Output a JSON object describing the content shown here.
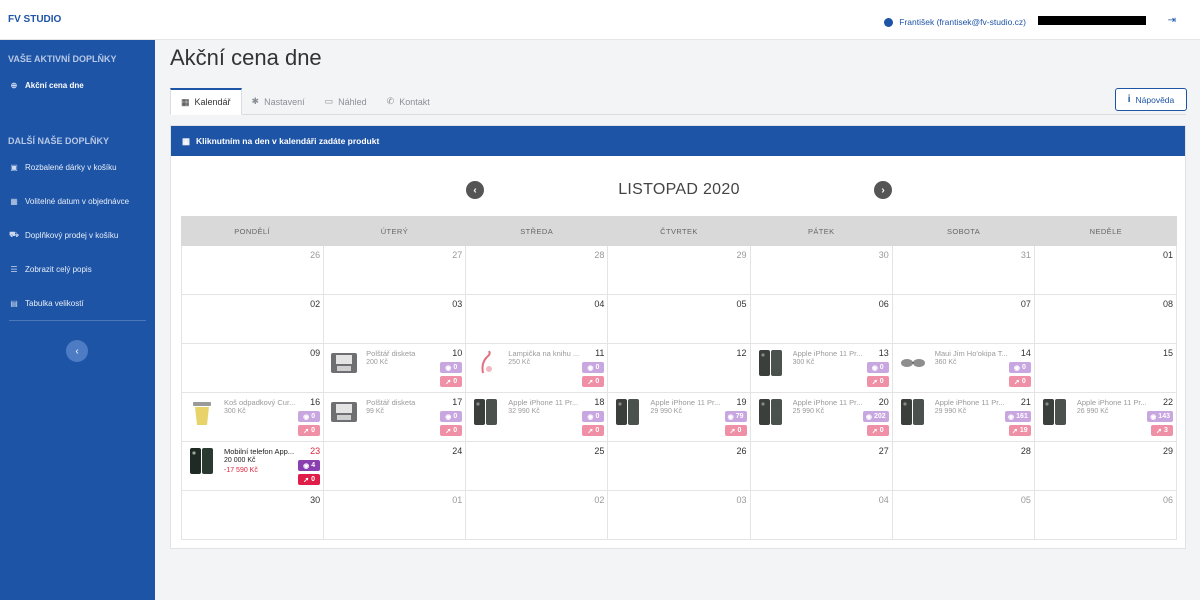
{
  "app": {
    "brand": "FV STUDIO"
  },
  "sidebar": {
    "active_heading": "VAŠE AKTIVNÍ DOPLŇKY",
    "active_item": "Akční cena dne",
    "more_heading": "DALŠÍ NAŠE DOPLŇKY",
    "items": [
      {
        "label": "Rozbalené dárky v košíku",
        "icon": "gift-icon"
      },
      {
        "label": "Volitelné datum v objednávce",
        "icon": "calendar-icon"
      },
      {
        "label": "Doplňkový prodej v košíku",
        "icon": "cart-icon"
      },
      {
        "label": "Zobrazit celý popis",
        "icon": "list-icon"
      },
      {
        "label": "Tabulka velikostí",
        "icon": "table-icon"
      }
    ]
  },
  "header": {
    "user": "František (frantisek@fv-studio.cz)"
  },
  "page": {
    "title": "Akční cena dne",
    "tabs": [
      {
        "label": "Kalendář",
        "icon": "calendar-icon"
      },
      {
        "label": "Nastavení",
        "icon": "gear-icon"
      },
      {
        "label": "Náhled",
        "icon": "monitor-icon"
      },
      {
        "label": "Kontakt",
        "icon": "phone-icon"
      }
    ],
    "help": "Nápověda"
  },
  "calendar": {
    "header_text": "Kliknutním na den v kalendáři zadáte produkt",
    "month": "LISTOPAD 2020",
    "weekdays": [
      "PONDĚLÍ",
      "ÚTERÝ",
      "STŘEDA",
      "ČTVRTEK",
      "PÁTEK",
      "SOBOTA",
      "NEDĚLE"
    ],
    "days": [
      {
        "d": "26",
        "muted": true
      },
      {
        "d": "27",
        "muted": true
      },
      {
        "d": "28",
        "muted": true
      },
      {
        "d": "29",
        "muted": true
      },
      {
        "d": "30",
        "muted": true
      },
      {
        "d": "31",
        "muted": true
      },
      {
        "d": "01"
      },
      {
        "d": "02"
      },
      {
        "d": "03"
      },
      {
        "d": "04"
      },
      {
        "d": "05"
      },
      {
        "d": "06"
      },
      {
        "d": "07"
      },
      {
        "d": "08"
      },
      {
        "d": "09"
      },
      {
        "d": "10",
        "product": {
          "name": "Polštář disketa",
          "price": "200 Kč",
          "views": "0",
          "clicks": "0",
          "image": "pillow"
        }
      },
      {
        "d": "11",
        "product": {
          "name": "Lampička na knihu ...",
          "price": "250 Kč",
          "views": "0",
          "clicks": "0",
          "image": "lamp"
        }
      },
      {
        "d": "12"
      },
      {
        "d": "13",
        "product": {
          "name": "Apple iPhone 11 Pr...",
          "price": "300 Kč",
          "views": "0",
          "clicks": "0",
          "image": "phone"
        }
      },
      {
        "d": "14",
        "product": {
          "name": "Maui Jim Ho'okipa T...",
          "price": "360 Kč",
          "views": "0",
          "clicks": "0",
          "image": "glasses"
        }
      },
      {
        "d": "15"
      },
      {
        "d": "16",
        "product": {
          "name": "Koš odpadkový Cur...",
          "price": "300 Kč",
          "views": "0",
          "clicks": "0",
          "image": "bin"
        }
      },
      {
        "d": "17",
        "product": {
          "name": "Polštář disketa",
          "price": "99 Kč",
          "views": "0",
          "clicks": "0",
          "image": "pillow"
        }
      },
      {
        "d": "18",
        "product": {
          "name": "Apple iPhone 11 Pr...",
          "price": "32 990 Kč",
          "views": "0",
          "clicks": "0",
          "image": "phone"
        }
      },
      {
        "d": "19",
        "product": {
          "name": "Apple iPhone 11 Pr...",
          "price": "29 990 Kč",
          "views": "79",
          "clicks": "0",
          "image": "phone"
        }
      },
      {
        "d": "20",
        "product": {
          "name": "Apple iPhone 11 Pr...",
          "price": "25 990 Kč",
          "views": "202",
          "clicks": "0",
          "image": "phone"
        }
      },
      {
        "d": "21",
        "product": {
          "name": "Apple iPhone 11 Pr...",
          "price": "29 990 Kč",
          "views": "161",
          "clicks": "19",
          "image": "phone"
        }
      },
      {
        "d": "22",
        "product": {
          "name": "Apple iPhone 11 Pr...",
          "price": "26 990 Kč",
          "views": "143",
          "clicks": "3",
          "image": "phone"
        }
      },
      {
        "d": "23",
        "today": true,
        "product": {
          "name": "Mobilní telefon App...",
          "price": "20 000 Kč",
          "discount": "-17 590 Kč",
          "views": "4",
          "clicks": "0",
          "image": "phone-dark"
        }
      },
      {
        "d": "24"
      },
      {
        "d": "25"
      },
      {
        "d": "26"
      },
      {
        "d": "27"
      },
      {
        "d": "28"
      },
      {
        "d": "29"
      },
      {
        "d": "30"
      },
      {
        "d": "01",
        "muted": true
      },
      {
        "d": "02",
        "muted": true
      },
      {
        "d": "03",
        "muted": true
      },
      {
        "d": "04",
        "muted": true
      },
      {
        "d": "05",
        "muted": true
      },
      {
        "d": "06",
        "muted": true
      }
    ]
  },
  "colors": {
    "primary": "#1d54a6",
    "today_red": "#e0243c",
    "views": "#c8a6e0",
    "clicks": "#f090a6"
  }
}
